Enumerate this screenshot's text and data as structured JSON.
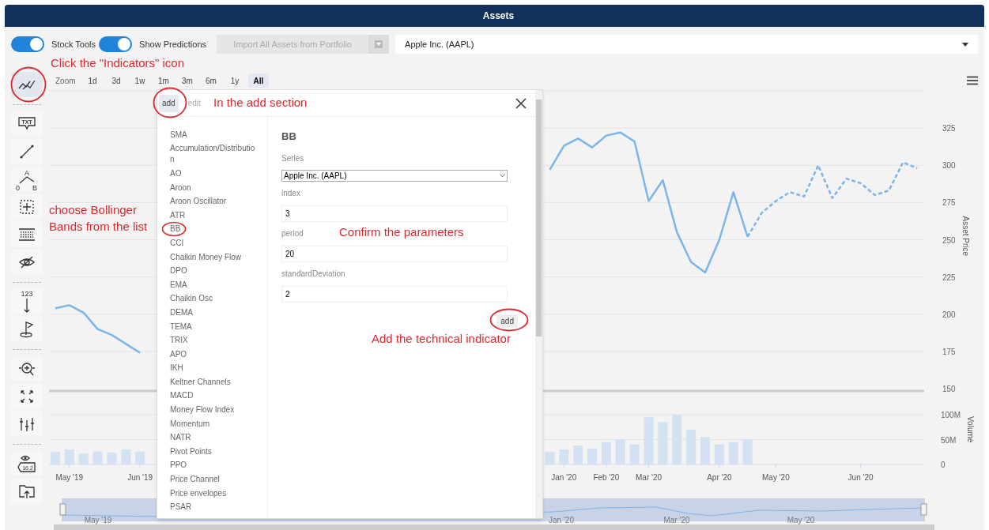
{
  "header": {
    "title": "Assets"
  },
  "toolbar": {
    "toggles": [
      {
        "label": "Stock Tools",
        "on": true
      },
      {
        "label": "Show Predictions",
        "on": true
      }
    ],
    "import_button": {
      "label": "Import All Assets from Portfolio",
      "disabled": true
    },
    "asset_select": {
      "value": "Apple Inc. (AAPL)"
    }
  },
  "tool_sidebar": {
    "groups": [
      [
        {
          "kind": "indicators",
          "selected": true
        }
      ],
      [
        {
          "kind": "callout",
          "text": "TXT",
          "selected": false
        },
        {
          "kind": "line",
          "selected": false
        },
        {
          "kind": "fibonacci",
          "labels": [
            "A",
            "0",
            "B"
          ],
          "selected": false
        },
        {
          "kind": "crosshair",
          "selected": false
        },
        {
          "kind": "grid",
          "selected": false
        },
        {
          "kind": "eye-off",
          "selected": false
        }
      ],
      [
        {
          "kind": "count",
          "text": "123",
          "selected": false
        },
        {
          "kind": "flag",
          "selected": false
        }
      ],
      [
        {
          "kind": "zoom",
          "selected": false
        },
        {
          "kind": "fullscreen",
          "selected": false
        },
        {
          "kind": "adjust",
          "selected": false
        }
      ],
      [
        {
          "kind": "eye-value",
          "text": "16.2",
          "selected": false
        },
        {
          "kind": "folder",
          "selected": false
        }
      ]
    ]
  },
  "range_selector": {
    "label": "Zoom",
    "buttons": [
      {
        "label": "1d",
        "selected": false
      },
      {
        "label": "3d",
        "selected": false
      },
      {
        "label": "1w",
        "selected": false
      },
      {
        "label": "1m",
        "selected": false
      },
      {
        "label": "3m",
        "selected": false
      },
      {
        "label": "6m",
        "selected": false
      },
      {
        "label": "1y",
        "selected": false
      },
      {
        "label": "All",
        "selected": true
      }
    ]
  },
  "price_chart": {
    "chart_data": {
      "type": "line",
      "ylabel": "Asset Price",
      "grid": true,
      "categories": [
        null,
        null,
        null,
        null,
        null,
        null,
        null,
        null,
        null,
        null,
        null,
        null,
        null,
        null,
        null,
        null,
        null,
        null,
        null,
        null,
        null,
        null,
        null,
        null,
        null,
        null,
        null,
        null,
        null,
        null,
        null,
        null,
        null,
        null,
        null,
        null,
        null,
        null,
        null,
        null,
        null,
        null,
        null,
        null,
        null,
        null,
        null,
        null,
        null,
        null,
        null,
        null,
        null,
        null,
        null,
        null,
        null,
        null,
        null,
        null,
        null,
        null
      ],
      "ylim": [
        150,
        350
      ],
      "yticks": [
        150,
        175,
        200,
        225,
        250,
        275,
        300,
        325
      ],
      "series": [
        {
          "color": "#7cb5ec",
          "line_style": "solid",
          "values": [
            204,
            206,
            201,
            190,
            186,
            180,
            174,
            null,
            null,
            null,
            null,
            null,
            null,
            null,
            null,
            null,
            null,
            null,
            null,
            null,
            null,
            null,
            null,
            null,
            null,
            null,
            null,
            null,
            null,
            null,
            null,
            null,
            null,
            null,
            null,
            297,
            313,
            318,
            312,
            320,
            322,
            316,
            276,
            290,
            255,
            235,
            228,
            250,
            282,
            252,
            null,
            null,
            null,
            null,
            null,
            null,
            null,
            null,
            null,
            null,
            null,
            null
          ]
        },
        {
          "color": "#7cb5ec",
          "line_style": "dashed",
          "values": [
            null,
            null,
            null,
            null,
            null,
            null,
            null,
            null,
            null,
            null,
            null,
            null,
            null,
            null,
            null,
            null,
            null,
            null,
            null,
            null,
            null,
            null,
            null,
            null,
            null,
            null,
            null,
            null,
            null,
            null,
            null,
            null,
            null,
            null,
            null,
            null,
            null,
            null,
            null,
            null,
            null,
            null,
            null,
            null,
            null,
            null,
            null,
            null,
            null,
            252,
            268,
            276,
            282,
            279,
            300,
            278,
            291,
            288,
            280,
            283,
            302,
            298
          ]
        }
      ]
    }
  },
  "volume_chart": {
    "chart_data": {
      "type": "bar",
      "ylabel": "Volume",
      "grid": true,
      "categories": [
        null,
        "May '19",
        null,
        null,
        null,
        null,
        "Jun '19",
        null,
        null,
        null,
        null,
        null,
        null,
        null,
        null,
        null,
        null,
        null,
        null,
        null,
        null,
        null,
        null,
        null,
        null,
        null,
        null,
        null,
        null,
        null,
        null,
        null,
        null,
        null,
        null,
        null,
        "Jan '20",
        null,
        null,
        "Feb '20",
        null,
        null,
        "Mar '20",
        null,
        null,
        null,
        null,
        "Apr '20",
        null,
        null,
        null,
        "May '20",
        null,
        null,
        null,
        null,
        null,
        "Jun '20",
        null,
        null,
        null,
        null
      ],
      "ylim": [
        0,
        100
      ],
      "yticks": [
        0,
        {
          "value": 50,
          "label": "50M"
        },
        {
          "value": 100,
          "label": "100M"
        }
      ],
      "series": [
        {
          "color": "#d3e2f3",
          "values": [
            25,
            30,
            22,
            26,
            24,
            30,
            26,
            null,
            null,
            null,
            null,
            null,
            null,
            null,
            null,
            null,
            null,
            null,
            null,
            null,
            null,
            null,
            null,
            null,
            null,
            null,
            null,
            null,
            null,
            null,
            null,
            null,
            null,
            null,
            null,
            25,
            30,
            38,
            32,
            45,
            50,
            40,
            95,
            85,
            100,
            70,
            55,
            40,
            45,
            50,
            null,
            null,
            null,
            null,
            null,
            null,
            null,
            null,
            null,
            null,
            null,
            null
          ]
        }
      ]
    }
  },
  "navigator": {
    "labels": [
      "May '19",
      "Jan '20",
      "Mar '20",
      "May '20"
    ]
  },
  "indicator_dialog": {
    "tabs": [
      {
        "label": "add",
        "selected": true
      },
      {
        "label": "edit",
        "selected": false
      }
    ],
    "indicators": [
      "SMA",
      "Accumulation/Distribution",
      "AO",
      "Aroon",
      "Aroon Oscillator",
      "ATR",
      "BB",
      "CCI",
      "Chaikin Money Flow",
      "DPO",
      "EMA",
      "Chaikin Osc",
      "DEMA",
      "TEMA",
      "TRIX",
      "APO",
      "IKH",
      "Keltner Channels",
      "MACD",
      "Money Flow Index",
      "Momentum",
      "NATR",
      "Pivot Points",
      "PPO",
      "Price Channel",
      "Price envelopes",
      "PSAR"
    ],
    "form": {
      "title": "BB",
      "fields": [
        {
          "label": "Series",
          "kind": "select",
          "value": "Apple Inc. (AAPL)"
        },
        {
          "label": "index",
          "kind": "input",
          "value": "3"
        },
        {
          "label": "period",
          "kind": "input",
          "value": "20"
        },
        {
          "label": "standardDeviation",
          "kind": "input",
          "value": "2"
        }
      ],
      "submit": "add"
    }
  },
  "annotations": [
    "Click the \"Indicators\" icon",
    "In the add section",
    "choose Bollinger Bands from the list",
    "Confirm the parameters",
    "Add the technical indicator"
  ]
}
